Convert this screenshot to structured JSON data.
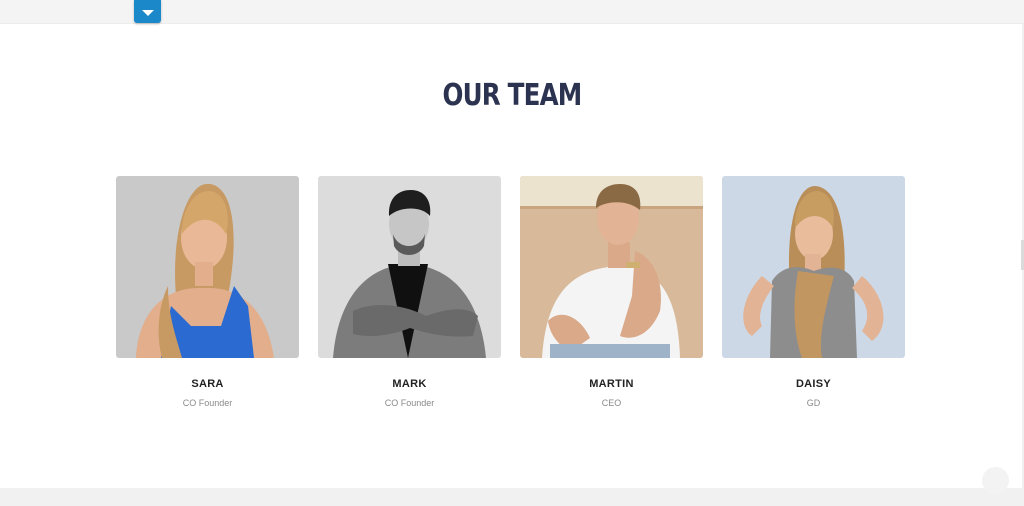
{
  "section": {
    "title": "OUR TEAM"
  },
  "team": [
    {
      "name": "SARA",
      "role": "CO Founder"
    },
    {
      "name": "MARK",
      "role": "CO Founder"
    },
    {
      "name": "MARTIN",
      "role": "CEO"
    },
    {
      "name": "DAISY",
      "role": "GD"
    }
  ],
  "colors": {
    "title": "#2c3350",
    "accent": "#1a88c9",
    "name": "#222222",
    "role": "#8a8a8a"
  },
  "icons": {
    "dropdown": "chevron-down-icon",
    "scroll": "scroll-top-icon"
  }
}
